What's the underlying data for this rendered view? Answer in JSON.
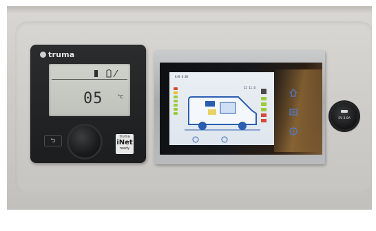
{
  "control_panel": {
    "brand": "truma",
    "display_value": "05",
    "display_unit": "°C",
    "back_glyph": "⮌",
    "badge": {
      "top": "truma",
      "main": "iNet",
      "bottom": "ready"
    }
  },
  "touch_display": {
    "status_left": "0/0 0.0V",
    "status_right": "12 11.6",
    "icons": [
      "home-icon",
      "list-icon",
      "info-icon"
    ]
  },
  "usb_socket": {
    "label": "5V 3.0A"
  },
  "colors": {
    "panel": "#1c1d1f",
    "lcd": "#c6c9c2",
    "screen_blue": "#2a5db0",
    "level_green": "#9acb3c",
    "level_yellow": "#e2c22a",
    "level_red": "#d44a3a"
  }
}
